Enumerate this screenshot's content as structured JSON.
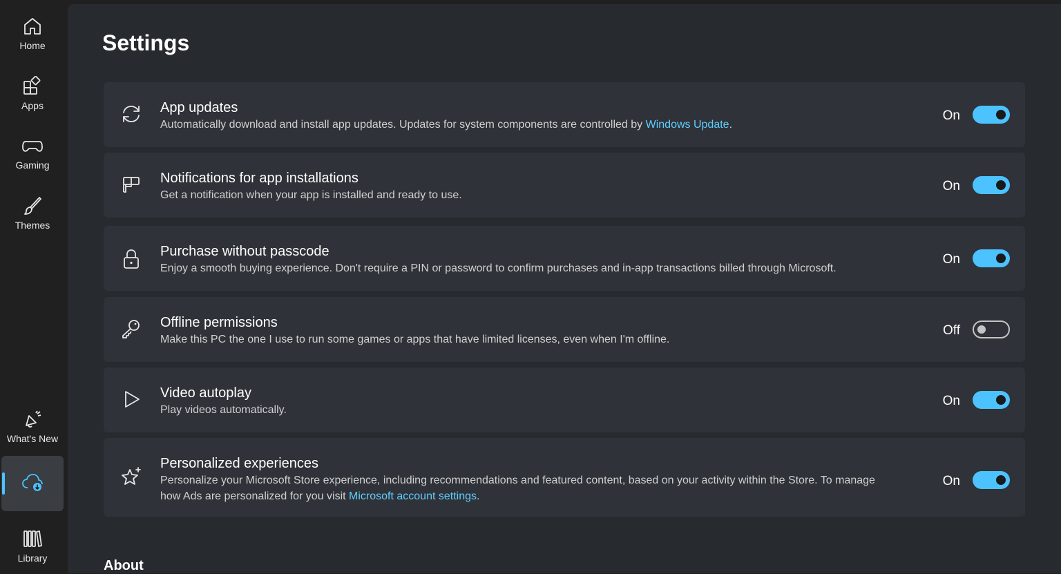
{
  "sidebar": {
    "items": [
      {
        "label": "Home",
        "icon": "home-icon"
      },
      {
        "label": "Apps",
        "icon": "apps-icon"
      },
      {
        "label": "Gaming",
        "icon": "gamepad-icon"
      },
      {
        "label": "Themes",
        "icon": "brush-icon"
      },
      {
        "label": "What's New",
        "icon": "megaphone-icon"
      },
      {
        "label": "",
        "icon": "cloud-download-icon"
      },
      {
        "label": "Library",
        "icon": "library-icon"
      }
    ],
    "accent_color": "#4cc2ff"
  },
  "page": {
    "title": "Settings",
    "section_heading": "About"
  },
  "settings": [
    {
      "title": "App updates",
      "desc_before": "Automatically download and install app updates. Updates for system components are controlled by ",
      "link": "Windows Update",
      "desc_after": ".",
      "state": "On",
      "icon": "refresh-icon"
    },
    {
      "title": "Notifications for app installations",
      "desc_before": "Get a notification when your app is installed and ready to use.",
      "link": "",
      "desc_after": "",
      "state": "On",
      "icon": "notification-icon"
    },
    {
      "title": "Purchase without passcode",
      "desc_before": "Enjoy a smooth buying experience. Don't require a PIN or password to confirm purchases and in-app transactions billed through Microsoft.",
      "link": "",
      "desc_after": "",
      "state": "On",
      "icon": "lock-icon"
    },
    {
      "title": "Offline permissions",
      "desc_before": "Make this PC the one I use to run some games or apps that have limited licenses, even when I'm offline.",
      "link": "",
      "desc_after": "",
      "state": "Off",
      "icon": "key-icon"
    },
    {
      "title": "Video autoplay",
      "desc_before": "Play videos automatically.",
      "link": "",
      "desc_after": "",
      "state": "On",
      "icon": "play-icon"
    },
    {
      "title": "Personalized experiences",
      "desc_before": "Personalize your Microsoft Store experience, including recommendations and featured content, based on your activity within the Store. To manage how Ads are personalized for you visit ",
      "link": "Microsoft account settings",
      "desc_after": ".",
      "state": "On",
      "icon": "sparkle-star-icon"
    }
  ]
}
